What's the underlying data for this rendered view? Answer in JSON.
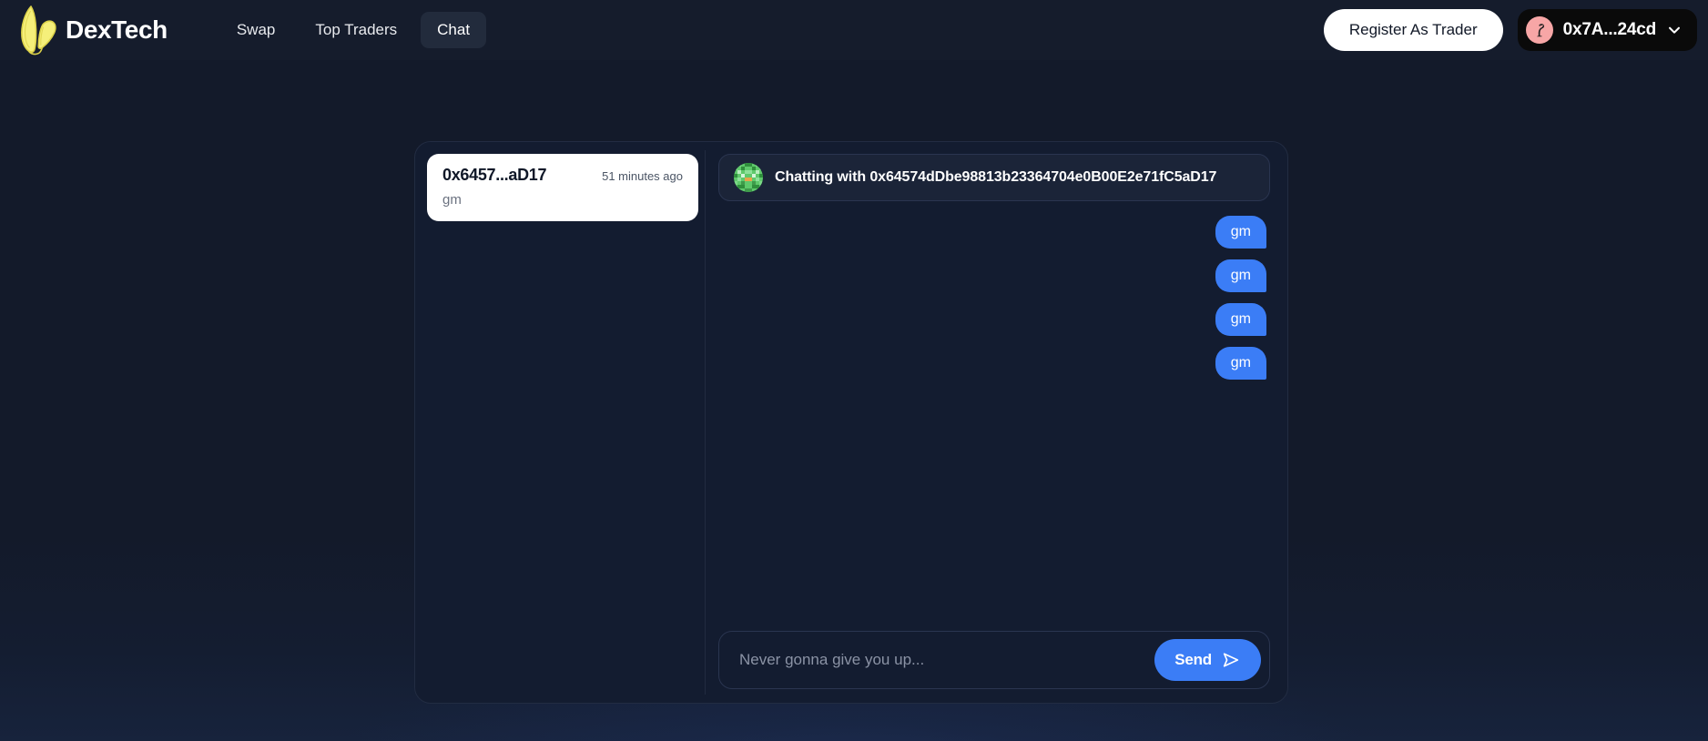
{
  "header": {
    "brand": {
      "name": "DexTech",
      "logo_icon": "bunny-ears-logo"
    },
    "nav": [
      {
        "label": "Swap",
        "active": false
      },
      {
        "label": "Top Traders",
        "active": false
      },
      {
        "label": "Chat",
        "active": true
      }
    ],
    "register_button": {
      "label": "Register As Trader"
    },
    "wallet": {
      "address_short": "0x7A...24cd",
      "avatar_icon": "flamingo-icon",
      "chevron_icon": "chevron-down-icon"
    }
  },
  "chat": {
    "conversations": [
      {
        "address_short": "0x6457...aD17",
        "timestamp": "51 minutes ago",
        "preview": "gm",
        "selected": true
      }
    ],
    "active_thread": {
      "header_prefix": "Chatting with",
      "peer_address": "0x64574dDbe98813b23364704e0B00E2e71fC5aD17",
      "header_title": "Chatting with 0x64574dDbe98813b23364704e0B00E2e71fC5aD17",
      "peer_avatar_icon": "blockie-identicon-green",
      "messages": [
        {
          "text": "gm",
          "direction": "out"
        },
        {
          "text": "gm",
          "direction": "out"
        },
        {
          "text": "gm",
          "direction": "out"
        },
        {
          "text": "gm",
          "direction": "out"
        }
      ]
    },
    "composer": {
      "value": "",
      "placeholder": "Never gonna give you up...",
      "send_label": "Send",
      "send_icon": "paper-plane-icon"
    }
  },
  "colors": {
    "page_bg": "#131a2a",
    "header_bg": "#151c2c",
    "panel_bg": "#131c30",
    "panel_border": "#222c42",
    "accent_blue": "#3b7df6",
    "brand_yellow": "#f2e96b",
    "avatar_pink": "#f7a6a6",
    "conv_card_bg": "#ffffff"
  }
}
